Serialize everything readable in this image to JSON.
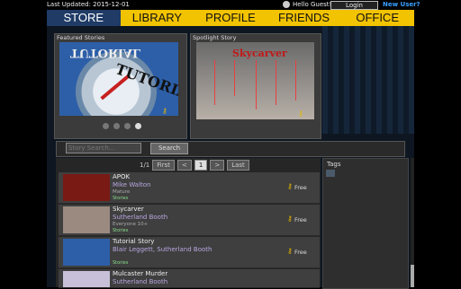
{
  "topbar": {
    "last_updated": "Last Updated: 2015-12-01",
    "greeting": "Hello Guest!",
    "login_label": "Login",
    "new_user_label": "New User?"
  },
  "nav": {
    "tabs": [
      {
        "label": "STORE",
        "active": true
      },
      {
        "label": "LIBRARY",
        "active": false
      },
      {
        "label": "PROFILE",
        "active": false
      },
      {
        "label": "FRIENDS",
        "active": false
      },
      {
        "label": "OFFICE",
        "active": false
      }
    ]
  },
  "featured": {
    "title": "Featured Stories",
    "image_caption": "TUTORIAL",
    "image_caption_mirrored": "TUTORIAL",
    "slides": 4,
    "active_slide": 3
  },
  "spotlight": {
    "title": "Spotlight Story",
    "image_caption": "Skycarver"
  },
  "search": {
    "placeholder": "Story Search...",
    "button_label": "Search"
  },
  "pager": {
    "page_info": "1/1",
    "first": "First",
    "prev": "<",
    "current": "1",
    "next": ">",
    "last": "Last"
  },
  "stories": [
    {
      "title": "APOK",
      "author": "Mike Walton",
      "rating": "Mature",
      "type": "Stories",
      "price": "Free",
      "thumb_color": "#7a1a14"
    },
    {
      "title": "Skycarver",
      "author": "Sutherland Booth",
      "rating": "Everyone 10+",
      "type": "Stories",
      "price": "Free",
      "thumb_color": "#9a8a80"
    },
    {
      "title": "Tutorial Story",
      "author": "Blair Leggett, Sutherland Booth",
      "rating": "",
      "type": "Stories",
      "price": "Free",
      "thumb_color": "#2d5fa8"
    },
    {
      "title": "Mulcaster Murder",
      "author": "Sutherland Booth",
      "rating": "",
      "type": "",
      "price": "",
      "thumb_color": "#c8c0d8"
    }
  ],
  "tags": {
    "title": "Tags"
  },
  "colors": {
    "nav_yellow": "#f2c300",
    "nav_active": "#1f3b66",
    "link_blue": "#3aa0ff",
    "author_purple": "#b8a8e0",
    "key_gold": "#e6b800"
  },
  "icons": {
    "guest": "user-circle-icon",
    "key": "key-icon"
  }
}
